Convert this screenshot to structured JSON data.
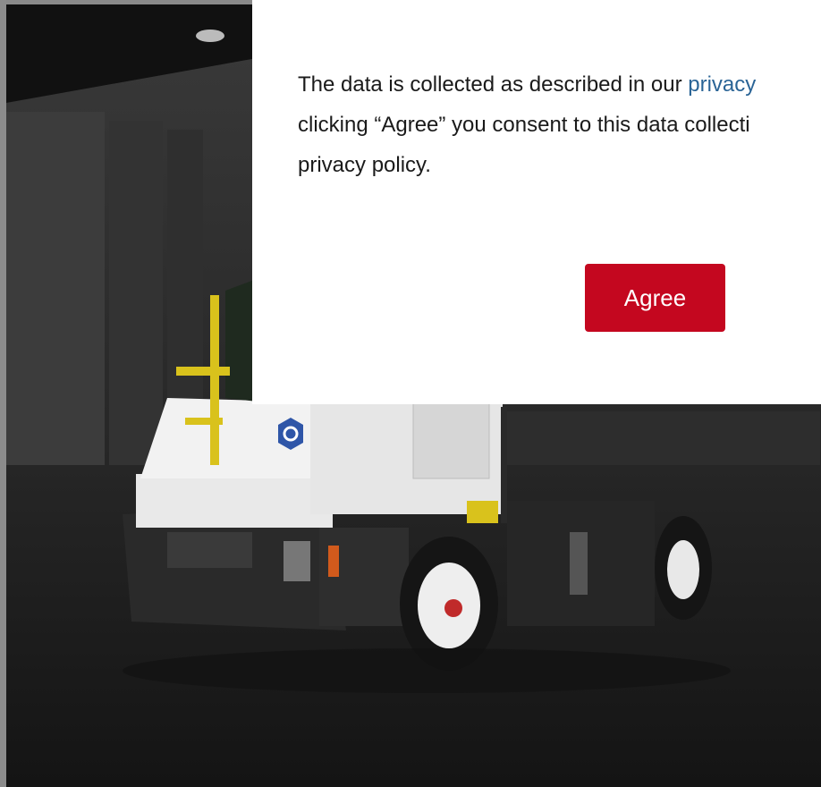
{
  "consent": {
    "line1_prefix": "The data is collected as described in our ",
    "privacy_link": "privacy",
    "line2": "clicking “Agree” you consent to this data collecti",
    "line3": "privacy policy.",
    "agree_label": "Agree"
  },
  "colors": {
    "accent": "#c4071f",
    "link": "#2a6496",
    "truck_logo": "#2f56a8"
  }
}
